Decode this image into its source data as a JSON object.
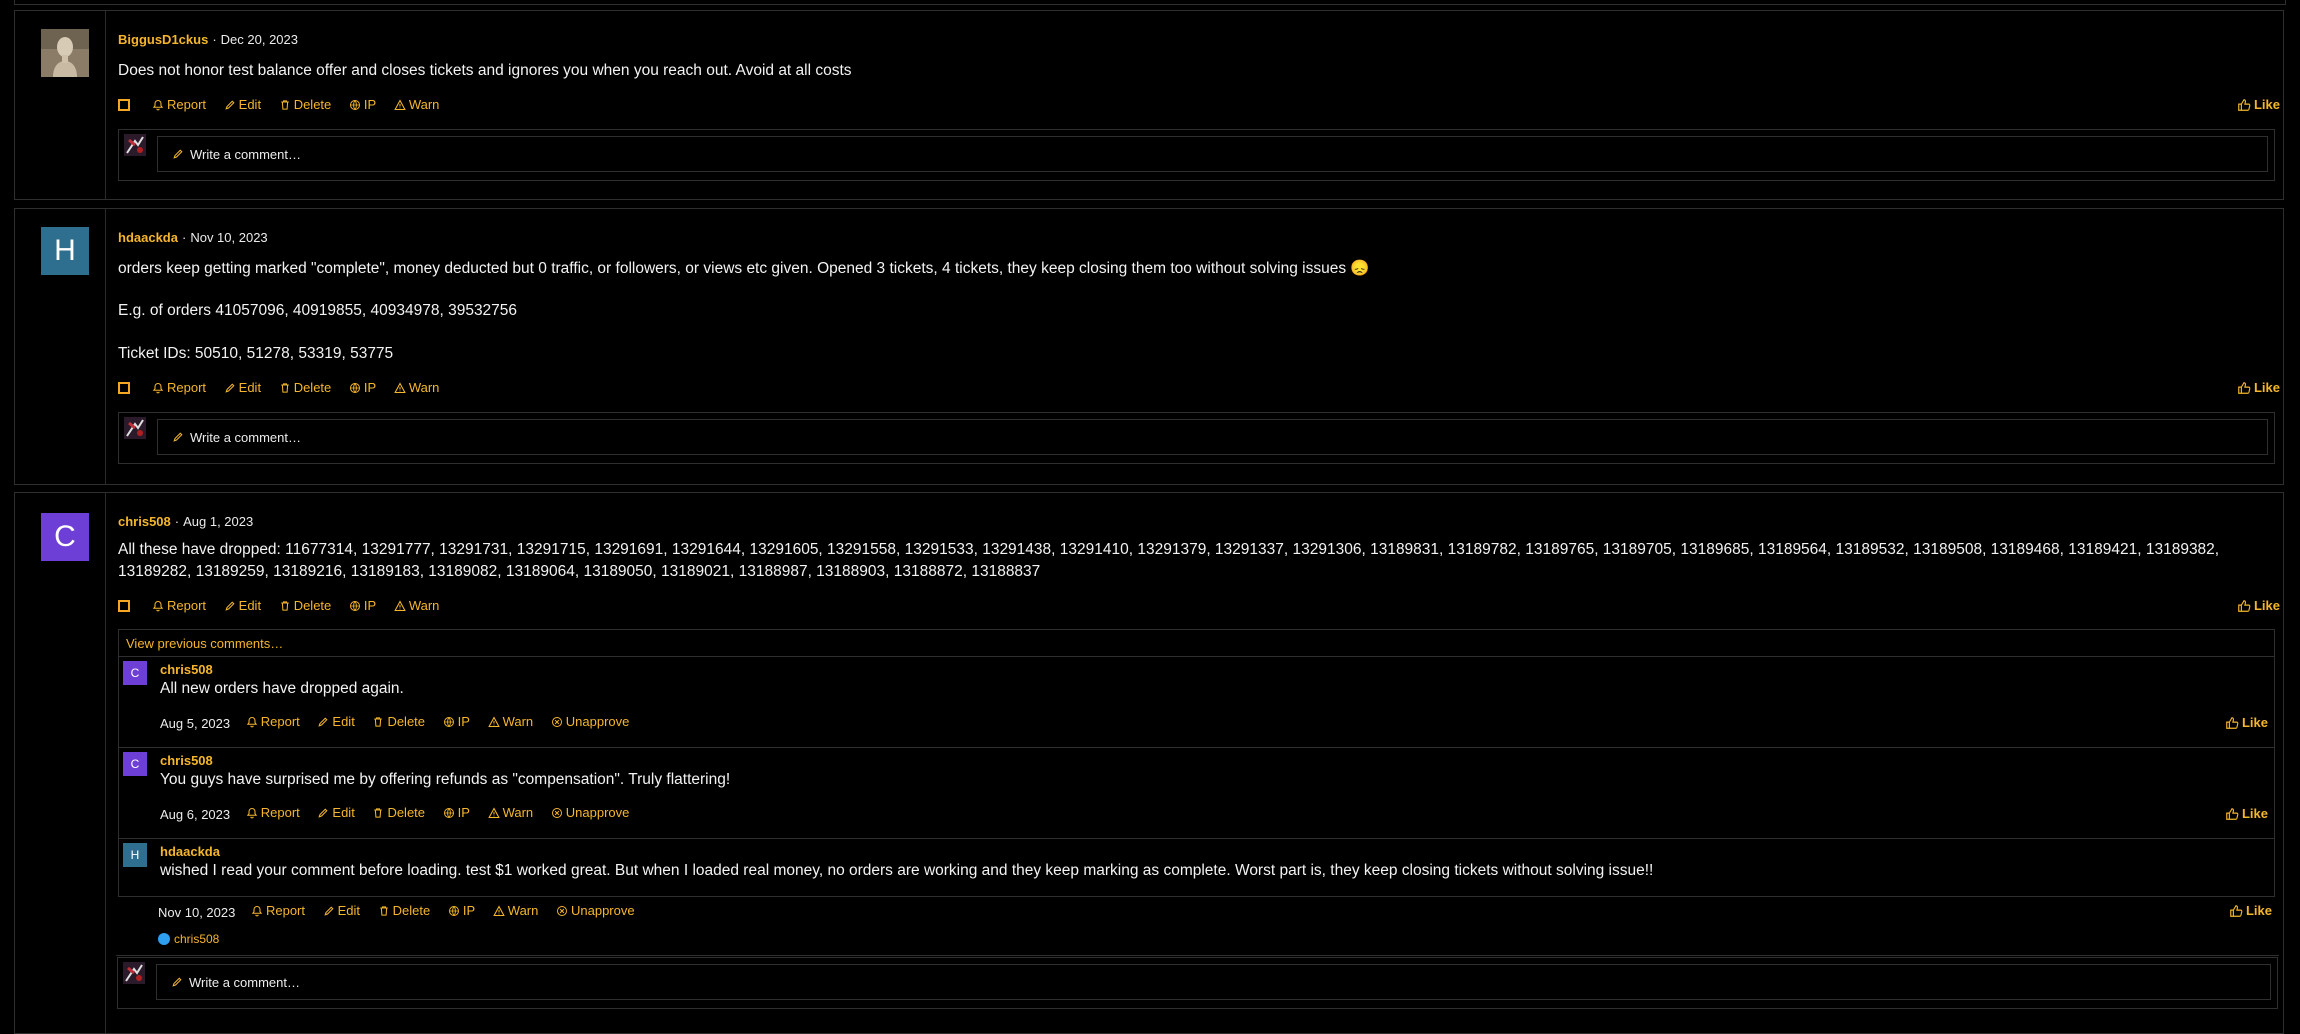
{
  "colors": {
    "accent": "#f5b62d",
    "border": "#2f2f2f",
    "avatar_h": "#2e6e8e",
    "avatar_c": "#6e3fd6"
  },
  "actions": {
    "report": "Report",
    "edit": "Edit",
    "delete": "Delete",
    "ip": "IP",
    "warn": "Warn",
    "unapprove": "Unapprove",
    "like": "Like",
    "write_comment": "Write a comment…",
    "view_previous": "View previous comments…"
  },
  "posts": [
    {
      "author": "BiggusD1ckus",
      "date": "Dec 20, 2023",
      "lines": [
        "Does not honor test balance offer and closes tickets and ignores you when you reach out. Avoid at all costs"
      ]
    },
    {
      "author": "hdaackda",
      "avatar_letter": "H",
      "date": "Nov 10, 2023",
      "lines": [
        "orders keep getting marked \"complete\", money deducted but 0 traffic, or followers, or views etc given. Opened 3 tickets, 4 tickets, they keep closing them too without solving issues 😞",
        "E.g. of orders 41057096, 40919855, 40934978, 39532756",
        "Ticket IDs: 50510, 51278, 53319, 53775"
      ]
    },
    {
      "author": "chris508",
      "avatar_letter": "C",
      "date": "Aug 1, 2023",
      "lines": [
        "All these have dropped: 11677314, 13291777, 13291731, 13291715, 13291691, 13291644, 13291605, 13291558, 13291533, 13291438, 13291410, 13291379, 13291337, 13291306, 13189831, 13189782, 13189765, 13189705, 13189685, 13189564, 13189532, 13189508, 13189468, 13189421, 13189382,",
        "13189282, 13189259, 13189216, 13189183, 13189082, 13189064, 13189050, 13189021, 13188987, 13188903, 13188872, 13188837"
      ],
      "replies": [
        {
          "author": "chris508",
          "avatar_letter": "C",
          "text": "All new orders have dropped again.",
          "date": "Aug 5, 2023"
        },
        {
          "author": "chris508",
          "avatar_letter": "C",
          "text": "You guys have surprised me by offering refunds as \"compensation\". Truly flattering!",
          "date": "Aug 6, 2023"
        },
        {
          "author": "hdaackda",
          "avatar_letter": "H",
          "text": "wished I read your comment before loading. test $1 worked great. But when I loaded real money, no orders are working and they keep marking as complete. Worst part is, they keep closing tickets without solving issue!!",
          "date": "Nov 10, 2023",
          "reaction_by": "chris508"
        }
      ]
    }
  ]
}
